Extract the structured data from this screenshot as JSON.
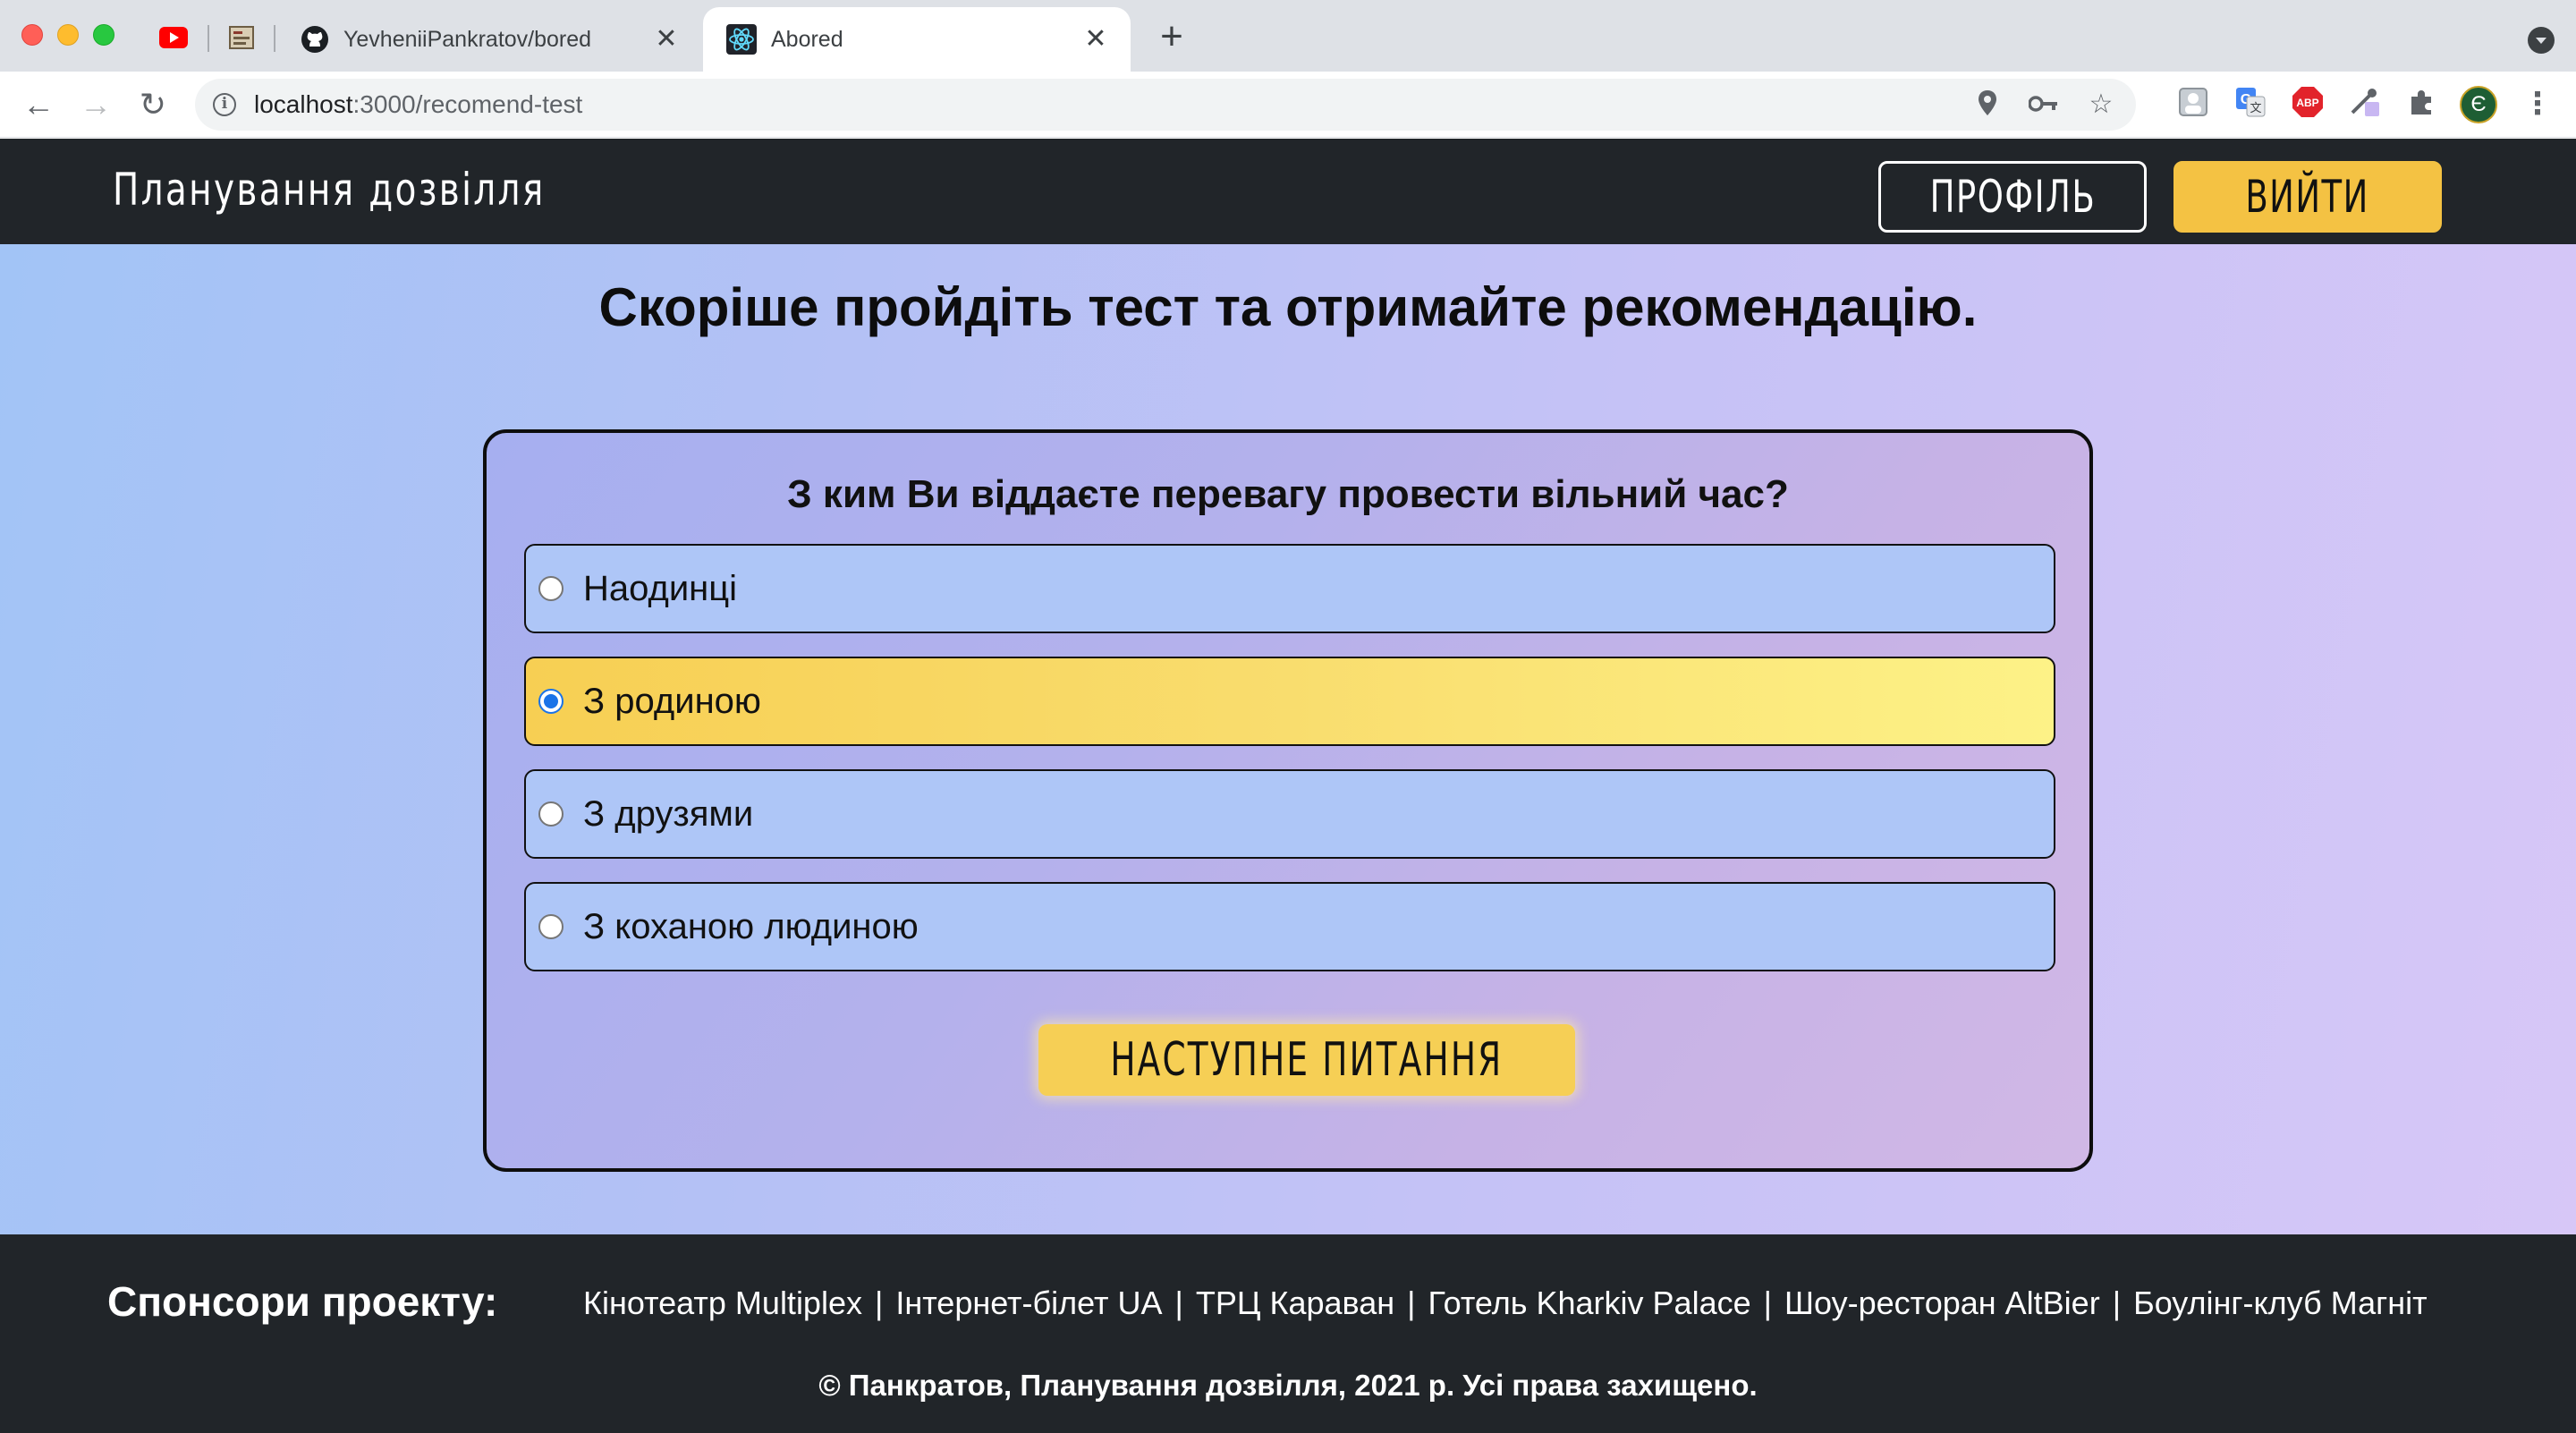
{
  "browser": {
    "tabs": [
      {
        "title": "YevheniiPankratov/bored",
        "icon": "github-icon"
      },
      {
        "title": "Abored",
        "icon": "react-icon",
        "active": true
      }
    ],
    "pinned_tabs": [
      "youtube-icon",
      "bookmarks-icon"
    ],
    "url_host": "localhost",
    "url_path": ":3000/recomend-test",
    "avatar_letter": "Є"
  },
  "header": {
    "brand": "Планування дозвілля",
    "profile_label": "ПРОФІЛЬ",
    "logout_label": "ВИЙТИ"
  },
  "main": {
    "title": "Скоріше пройдіть тест та отримайте рекомендацію.",
    "quiz": {
      "question": "З ким Ви віддаєте перевагу провести вільний час?",
      "options": [
        {
          "label": "Наодинці",
          "selected": false
        },
        {
          "label": "З родиною",
          "selected": true
        },
        {
          "label": "З друзями",
          "selected": false
        },
        {
          "label": "З коханою людиною",
          "selected": false
        }
      ],
      "next_label": "НАСТУПНЕ ПИТАННЯ"
    }
  },
  "footer": {
    "sponsors_title": "Спонсори проекту:",
    "sponsors": [
      "Кінотеатр Multiplex",
      "Інтернет-білет UA",
      "ТРЦ Караван",
      "Готель Kharkiv Palace",
      "Шоу-ресторан AltBier",
      "Боулінг-клуб Магніт"
    ],
    "copyright": "© Панкратов, Планування дозвілля, 2021 р. Усі права захищено."
  },
  "colors": {
    "header_bg": "#212529",
    "accent_yellow": "#f4c243",
    "option_bg": "#aec6f7",
    "radio_checked": "#1a73e8"
  }
}
